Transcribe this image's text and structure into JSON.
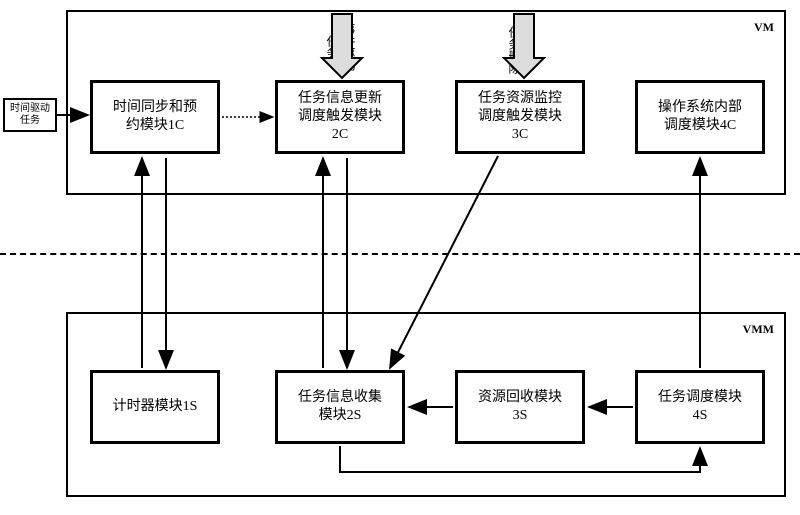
{
  "chart_data": {
    "type": "diagram",
    "containers": [
      {
        "id": "VM",
        "label": "VM"
      },
      {
        "id": "VMM",
        "label": "VMM"
      }
    ],
    "external_inputs": [
      {
        "id": "time_driven_task",
        "label": "时间驱动任务",
        "target": "1C"
      },
      {
        "id": "event_driven_task",
        "label": "事件驱动任务",
        "target": "2C"
      },
      {
        "id": "task_deletion",
        "label": "任务删除",
        "target": "3C"
      }
    ],
    "modules": [
      {
        "id": "1C",
        "container": "VM",
        "label": "时间同步和预\n约模块1C"
      },
      {
        "id": "2C",
        "container": "VM",
        "label": "任务信息更新\n调度触发模块\n2C"
      },
      {
        "id": "3C",
        "container": "VM",
        "label": "任务资源监控\n调度触发模块\n3C"
      },
      {
        "id": "4C",
        "container": "VM",
        "label": "操作系统内部\n调度模块4C"
      },
      {
        "id": "1S",
        "container": "VMM",
        "label": "计时器模块1S"
      },
      {
        "id": "2S",
        "container": "VMM",
        "label": "任务信息收集\n模块2S"
      },
      {
        "id": "3S",
        "container": "VMM",
        "label": "资源回收模块\n3S"
      },
      {
        "id": "4S",
        "container": "VMM",
        "label": "任务调度模块\n4S"
      }
    ],
    "edges": [
      {
        "from": "time_driven_task",
        "to": "1C",
        "bidirectional": false
      },
      {
        "from": "event_driven_task",
        "to": "2C",
        "bidirectional": false
      },
      {
        "from": "task_deletion",
        "to": "3C",
        "bidirectional": false
      },
      {
        "from": "1C",
        "to": "2C",
        "bidirectional": false
      },
      {
        "from": "1C",
        "to": "1S",
        "bidirectional": true
      },
      {
        "from": "2C",
        "to": "2S",
        "bidirectional": true
      },
      {
        "from": "3C",
        "to": "2S",
        "bidirectional": false
      },
      {
        "from": "4S",
        "to": "3S",
        "bidirectional": false
      },
      {
        "from": "3S",
        "to": "2S",
        "bidirectional": false
      },
      {
        "from": "2S",
        "to": "4S",
        "bidirectional": false
      },
      {
        "from": "4S",
        "to": "4C",
        "bidirectional": false
      }
    ]
  }
}
